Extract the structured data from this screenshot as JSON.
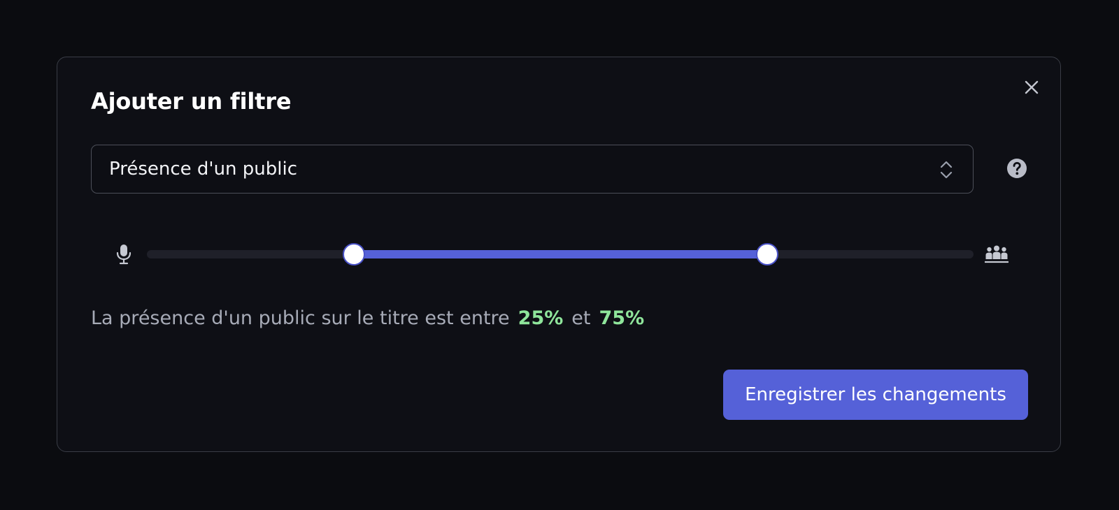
{
  "dialog": {
    "title": "Ajouter un filtre",
    "close_icon": "close-icon"
  },
  "filter_select": {
    "value": "Présence d'un public",
    "chevron_icon": "chevron-up-down-icon"
  },
  "help_icon": "question-circle-icon",
  "range_slider": {
    "min_icon": "microphone-icon",
    "max_icon": "audience-icon",
    "min_value_percent": 25,
    "max_value_percent": 75
  },
  "summary": {
    "text": "La présence d'un public sur le titre est entre",
    "low_value": "25%",
    "conjunction": "et",
    "high_value": "75%"
  },
  "save_button_label": "Enregistrer les changements",
  "colors": {
    "background": "#0b0c10",
    "modal_background": "#0e0f15",
    "accent": "#5561d8",
    "value_highlight": "#8fe59b"
  }
}
